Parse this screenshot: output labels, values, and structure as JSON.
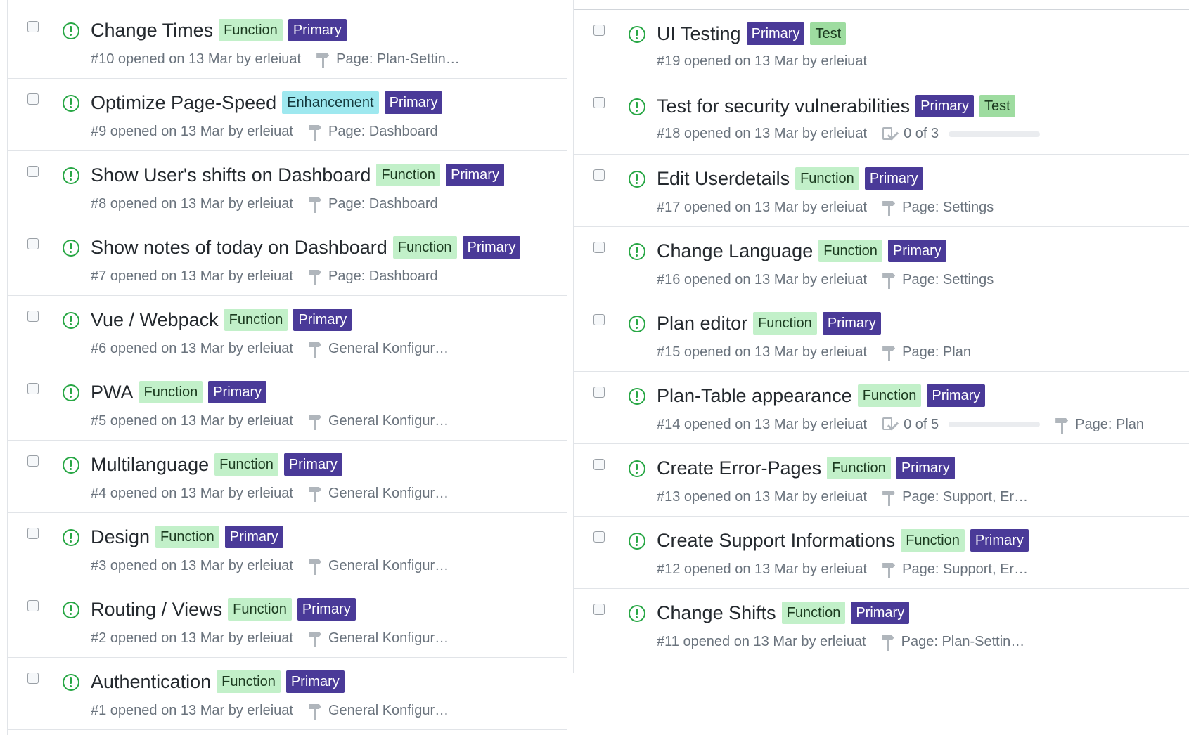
{
  "left_column": {
    "issues": [
      {
        "title": "Change Times",
        "labels": [
          {
            "text": "Function",
            "kind": "function"
          },
          {
            "text": "Primary",
            "kind": "primary"
          }
        ],
        "meta": "#10 opened on 13 Mar by erleiuat",
        "milestone": "Page: Plan-Settin…"
      },
      {
        "title": "Optimize Page-Speed",
        "labels": [
          {
            "text": "Enhancement",
            "kind": "enhancement"
          },
          {
            "text": "Primary",
            "kind": "primary"
          }
        ],
        "meta": "#9 opened on 13 Mar by erleiuat",
        "milestone": "Page: Dashboard"
      },
      {
        "title": "Show User's shifts on Dashboard",
        "labels": [
          {
            "text": "Function",
            "kind": "function"
          },
          {
            "text": "Primary",
            "kind": "primary"
          }
        ],
        "meta": "#8 opened on 13 Mar by erleiuat",
        "milestone": "Page: Dashboard"
      },
      {
        "title": "Show notes of today on Dashboard",
        "labels": [
          {
            "text": "Function",
            "kind": "function"
          },
          {
            "text": "Primary",
            "kind": "primary"
          }
        ],
        "meta": "#7 opened on 13 Mar by erleiuat",
        "milestone": "Page: Dashboard"
      },
      {
        "title": "Vue / Webpack",
        "labels": [
          {
            "text": "Function",
            "kind": "function"
          },
          {
            "text": "Primary",
            "kind": "primary"
          }
        ],
        "meta": "#6 opened on 13 Mar by erleiuat",
        "milestone": "General Konfigur…"
      },
      {
        "title": "PWA",
        "labels": [
          {
            "text": "Function",
            "kind": "function"
          },
          {
            "text": "Primary",
            "kind": "primary"
          }
        ],
        "meta": "#5 opened on 13 Mar by erleiuat",
        "milestone": "General Konfigur…"
      },
      {
        "title": "Multilanguage",
        "labels": [
          {
            "text": "Function",
            "kind": "function"
          },
          {
            "text": "Primary",
            "kind": "primary"
          }
        ],
        "meta": "#4 opened on 13 Mar by erleiuat",
        "milestone": "General Konfigur…"
      },
      {
        "title": "Design",
        "labels": [
          {
            "text": "Function",
            "kind": "function"
          },
          {
            "text": "Primary",
            "kind": "primary"
          }
        ],
        "meta": "#3 opened on 13 Mar by erleiuat",
        "milestone": "General Konfigur…"
      },
      {
        "title": "Routing / Views",
        "labels": [
          {
            "text": "Function",
            "kind": "function"
          },
          {
            "text": "Primary",
            "kind": "primary"
          }
        ],
        "meta": "#2 opened on 13 Mar by erleiuat",
        "milestone": "General Konfigur…"
      },
      {
        "title": "Authentication",
        "labels": [
          {
            "text": "Function",
            "kind": "function"
          },
          {
            "text": "Primary",
            "kind": "primary"
          }
        ],
        "meta": "#1 opened on 13 Mar by erleiuat",
        "milestone": "General Konfigur…"
      }
    ]
  },
  "right_column": {
    "issues": [
      {
        "title": "UI Testing",
        "labels": [
          {
            "text": "Primary",
            "kind": "primary"
          },
          {
            "text": "Test",
            "kind": "test"
          }
        ],
        "meta": "#19 opened on 13 Mar by erleiuat"
      },
      {
        "title": "Test for security vulnerabilities",
        "labels": [
          {
            "text": "Primary",
            "kind": "primary"
          },
          {
            "text": "Test",
            "kind": "test"
          }
        ],
        "meta": "#18 opened on 13 Mar by erleiuat",
        "tasks": "0 of 3",
        "task_progress": 0
      },
      {
        "title": "Edit Userdetails",
        "labels": [
          {
            "text": "Function",
            "kind": "function"
          },
          {
            "text": "Primary",
            "kind": "primary"
          }
        ],
        "meta": "#17 opened on 13 Mar by erleiuat",
        "milestone": "Page: Settings"
      },
      {
        "title": "Change Language",
        "labels": [
          {
            "text": "Function",
            "kind": "function"
          },
          {
            "text": "Primary",
            "kind": "primary"
          }
        ],
        "meta": "#16 opened on 13 Mar by erleiuat",
        "milestone": "Page: Settings"
      },
      {
        "title": "Plan editor",
        "labels": [
          {
            "text": "Function",
            "kind": "function"
          },
          {
            "text": "Primary",
            "kind": "primary"
          }
        ],
        "meta": "#15 opened on 13 Mar by erleiuat",
        "milestone": "Page: Plan"
      },
      {
        "title": "Plan-Table appearance",
        "labels": [
          {
            "text": "Function",
            "kind": "function"
          },
          {
            "text": "Primary",
            "kind": "primary"
          }
        ],
        "meta": "#14 opened on 13 Mar by erleiuat",
        "tasks": "0 of 5",
        "task_progress": 0,
        "milestone": "Page: Plan"
      },
      {
        "title": "Create Error-Pages",
        "labels": [
          {
            "text": "Function",
            "kind": "function"
          },
          {
            "text": "Primary",
            "kind": "primary"
          }
        ],
        "meta": "#13 opened on 13 Mar by erleiuat",
        "milestone": "Page: Support, Er…"
      },
      {
        "title": "Create Support Informations",
        "labels": [
          {
            "text": "Function",
            "kind": "function"
          },
          {
            "text": "Primary",
            "kind": "primary"
          }
        ],
        "meta": "#12 opened on 13 Mar by erleiuat",
        "milestone": "Page: Support, Er…"
      },
      {
        "title": "Change Shifts",
        "labels": [
          {
            "text": "Function",
            "kind": "function"
          },
          {
            "text": "Primary",
            "kind": "primary"
          }
        ],
        "meta": "#11 opened on 13 Mar by erleiuat",
        "milestone": "Page: Plan-Settin…"
      }
    ]
  },
  "colors": {
    "open_icon": "#28a745",
    "function_label": "#c2f0c9",
    "primary_label": "#4a3a98",
    "enhancement_label": "#9ee8ef",
    "test_label": "#9edca0"
  }
}
